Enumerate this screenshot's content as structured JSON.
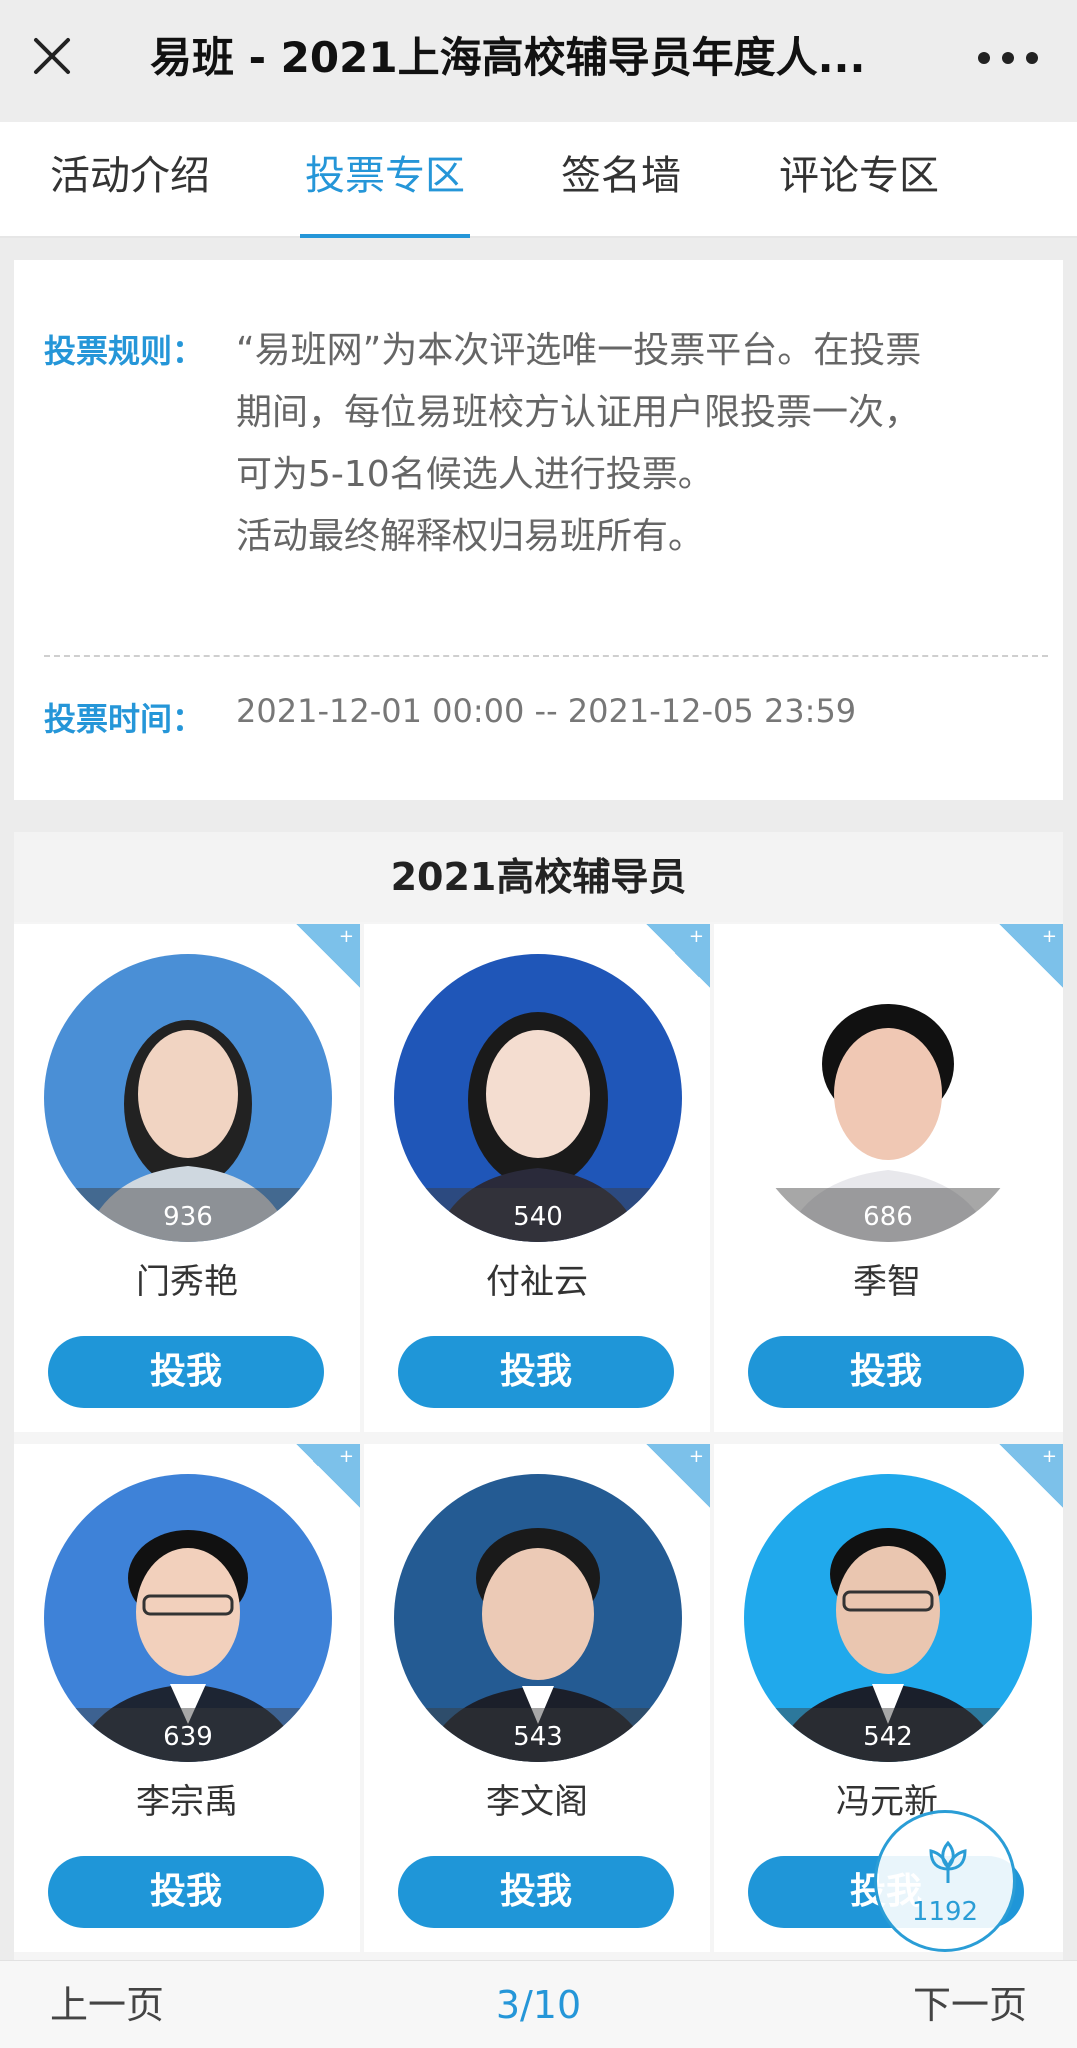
{
  "header": {
    "title": "易班 - 2021上海高校辅导员年度人..."
  },
  "tabs": [
    {
      "label": "活动介绍",
      "active": false
    },
    {
      "label": "投票专区",
      "active": true
    },
    {
      "label": "签名墙",
      "active": false
    },
    {
      "label": "评论专区",
      "active": false
    }
  ],
  "rules": {
    "rule_label": "投票规则：",
    "rule_lines": [
      "“易班网”为本次评选唯一投票平台。在投票",
      "期间，每位易班校方认证用户限投票一次，",
      "可为5-10名候选人进行投票。",
      "活动最终解释权归易班所有。"
    ],
    "time_label": "投票时间：",
    "time_value": "2021-12-01 00:00 -- 2021-12-05 23:59"
  },
  "section": {
    "title": "2021高校辅导员"
  },
  "candidates": [
    {
      "name": "门秀艳",
      "votes": "936",
      "vote_label": "投我",
      "bg": "#4a8fd6"
    },
    {
      "name": "付祉云",
      "votes": "540",
      "vote_label": "投我",
      "bg": "#1f56b8"
    },
    {
      "name": "季智",
      "votes": "686",
      "vote_label": "投我",
      "bg": "#ffffff"
    },
    {
      "name": "李宗禹",
      "votes": "639",
      "vote_label": "投我",
      "bg": "#3e82d8"
    },
    {
      "name": "李文阁",
      "votes": "543",
      "vote_label": "投我",
      "bg": "#245b93"
    },
    {
      "name": "冯元新",
      "votes": "542",
      "vote_label": "投我",
      "bg": "#20a9ec"
    }
  ],
  "corner_symbol": "+",
  "pager": {
    "prev": "上一页",
    "page": "3/10",
    "next": "下一页"
  },
  "floating": {
    "count": "1192"
  },
  "colors": {
    "accent": "#2596d8",
    "button": "#1f96d8"
  }
}
